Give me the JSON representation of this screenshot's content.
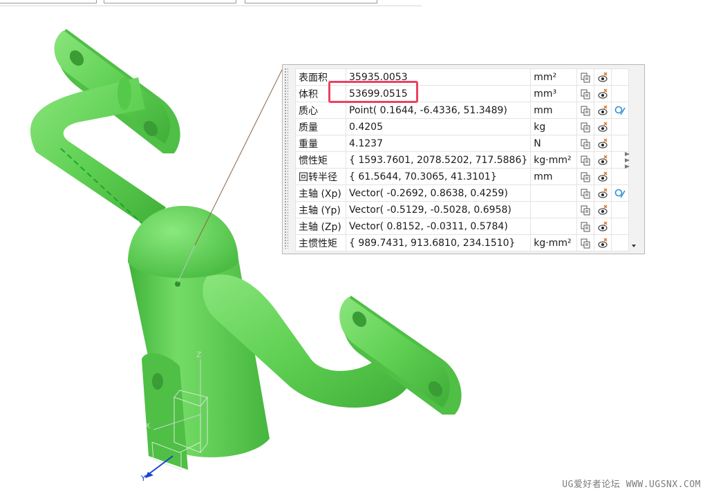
{
  "window": {
    "toolbar_fields": [
      "",
      "",
      ""
    ]
  },
  "viewport": {
    "model_color": "#62d456",
    "triad": {
      "x_label": "X",
      "y_label": "Y",
      "z_label": "Z"
    }
  },
  "properties_panel": {
    "highlighted_row": "体积",
    "rows": [
      {
        "label": "表面积",
        "value": "35935.0053",
        "unit": "mm²",
        "has_extra_icon": false
      },
      {
        "label": "体积",
        "value": "53699.0515",
        "unit": "mm³",
        "has_extra_icon": false
      },
      {
        "label": "质心",
        "value": "Point( 0.1644, -6.4336, 51.3489)",
        "unit": "mm",
        "has_extra_icon": true
      },
      {
        "label": "质量",
        "value": "0.4205",
        "unit": "kg",
        "has_extra_icon": false
      },
      {
        "label": "重量",
        "value": "4.1237",
        "unit": "N",
        "has_extra_icon": false
      },
      {
        "label": "惯性矩",
        "value": "{ 1593.7601, 2078.5202, 717.5886}",
        "unit": "kg·mm²",
        "has_extra_icon": false
      },
      {
        "label": "回转半径",
        "value": "{ 61.5644, 70.3065, 41.3101}",
        "unit": "mm",
        "has_extra_icon": false
      },
      {
        "label": "主轴 (Xp)",
        "value": "Vector( -0.2692, 0.8638, 0.4259)",
        "unit": "",
        "has_extra_icon": true
      },
      {
        "label": "主轴 (Yp)",
        "value": "Vector( -0.5129, -0.5028, 0.6958)",
        "unit": "",
        "has_extra_icon": false
      },
      {
        "label": "主轴 (Zp)",
        "value": "Vector( 0.8152, -0.0311, 0.5784)",
        "unit": "",
        "has_extra_icon": false
      },
      {
        "label": "主惯性矩",
        "value": "{ 989.7431, 913.6810, 234.1510}",
        "unit": "kg·mm²",
        "has_extra_icon": false
      }
    ],
    "icons": {
      "copy": "copy-to-clipboard-icon",
      "show": "show-in-graphics-icon",
      "extra": "display-geometry-icon"
    }
  },
  "watermark": "UG爱好者论坛 WWW.UGSNX.COM",
  "colors": {
    "highlight": "#ee4060",
    "accent_blue": "#2b8fd6"
  }
}
